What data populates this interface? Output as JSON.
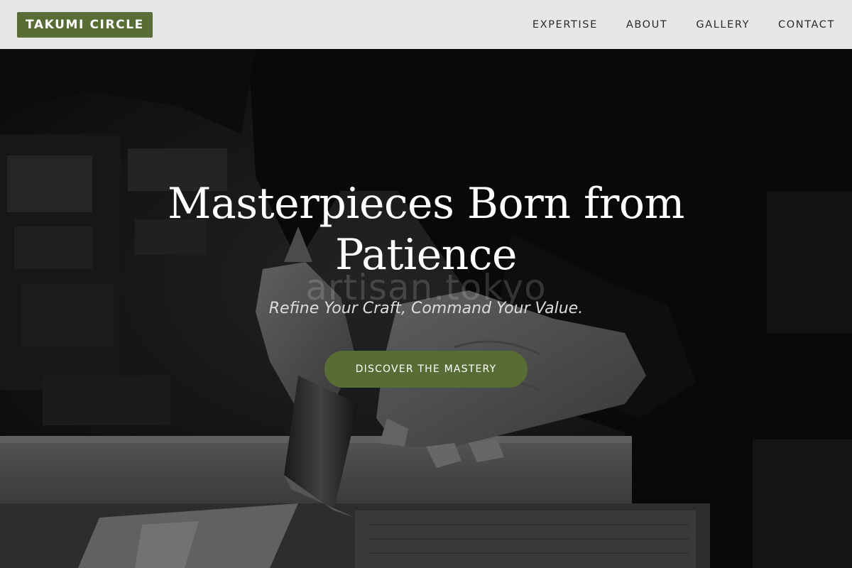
{
  "header": {
    "logo": "TAKUMI CIRCLE",
    "nav": [
      {
        "label": "EXPERTISE"
      },
      {
        "label": "ABOUT"
      },
      {
        "label": "GALLERY"
      },
      {
        "label": "CONTACT"
      }
    ]
  },
  "hero": {
    "title_line1": "Masterpieces Born from",
    "title_line2": "Patience",
    "subtitle": "Refine Your Craft, Command Your Value.",
    "watermark": "artisan.tokyo",
    "cta_label": "DISCOVER THE MASTERY"
  },
  "colors": {
    "accent": "#586c35",
    "header_bg": "#e7e7e7",
    "nav_text": "#2a2a2a"
  }
}
